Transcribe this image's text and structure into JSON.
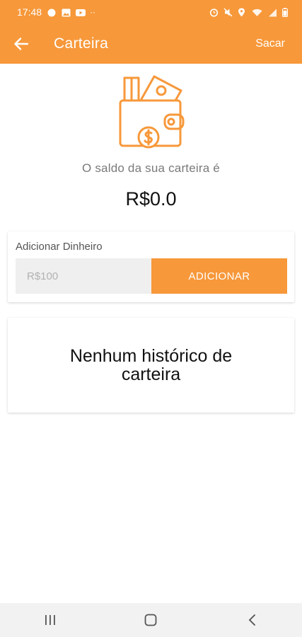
{
  "status_bar": {
    "time": "17:48",
    "left_icons": [
      "dot-icon",
      "gallery-icon",
      "youtube-icon",
      "more-notifications-icon"
    ],
    "right_icons": [
      "alarm-icon",
      "mute-icon",
      "location-icon",
      "wifi-icon",
      "signal-icon",
      "battery-icon"
    ]
  },
  "app_bar": {
    "title": "Carteira",
    "action_label": "Sacar",
    "back_icon": "arrow-left-icon"
  },
  "wallet": {
    "illustration_icon": "wallet-money-icon",
    "balance_label": "O saldo da sua carteira é",
    "balance_value": "R$0.0"
  },
  "add_money": {
    "label": "Adicionar Dinheiro",
    "input_placeholder": "R$100",
    "input_value": "",
    "button_label": "ADICIONAR"
  },
  "history": {
    "empty_message": "Nenhum histórico de carteira"
  },
  "nav_bar": {
    "recent_icon": "recent-apps-icon",
    "home_icon": "home-icon",
    "back_icon": "back-icon"
  },
  "colors": {
    "accent": "#f7983a",
    "input_bg": "#efefef",
    "navbar_bg": "#f2f2f2"
  }
}
